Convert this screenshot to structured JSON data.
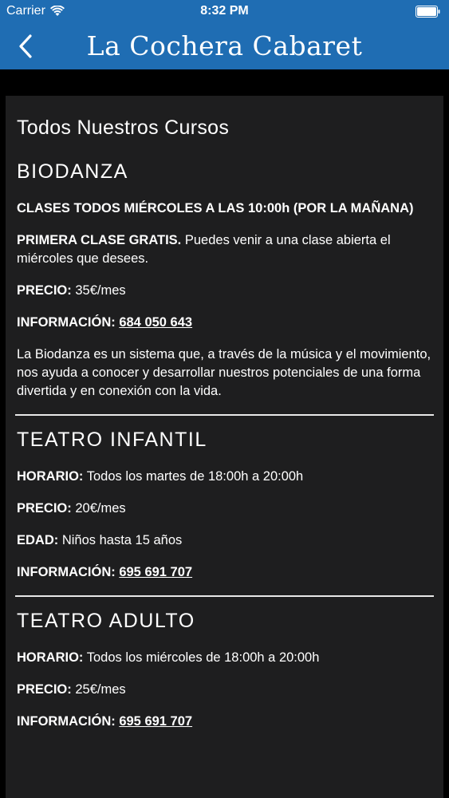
{
  "status_bar": {
    "carrier": "Carrier",
    "time": "8:32 PM"
  },
  "nav": {
    "title": "La Cochera Cabaret",
    "back_icon": "chevron-left-icon"
  },
  "colors": {
    "header_bg": "#1f6db3",
    "card_bg": "#1e1e1f",
    "page_bg": "#000000"
  },
  "page": {
    "title": "Todos Nuestros Cursos"
  },
  "courses": [
    {
      "name": "BIODANZA",
      "schedule": "CLASES TODOS MIÉRCOLES A LAS 10:00h (POR LA MAÑANA)",
      "first_class_label": "PRIMERA CLASE GRATIS.",
      "first_class_text": "Puedes venir a una clase abierta el miércoles que desees.",
      "price_label": "PRECIO:",
      "price": "35€/mes",
      "info_label": "INFORMACIÓN:",
      "phone": "684 050 643",
      "description": "La Biodanza es un sistema que, a través de la música y el movimiento, nos ayuda a conocer y desarrollar nuestros potenciales de una forma divertida y en conexión con la vida."
    },
    {
      "name": "TEATRO INFANTIL",
      "schedule_label": "HORARIO:",
      "schedule": "Todos los martes de 18:00h a 20:00h",
      "price_label": "PRECIO:",
      "price": "20€/mes",
      "age_label": "EDAD:",
      "age": "Niños hasta 15 años",
      "info_label": "INFORMACIÓN:",
      "phone": "695 691 707"
    },
    {
      "name": "TEATRO ADULTO",
      "schedule_label": "HORARIO:",
      "schedule": "Todos los miércoles de 18:00h a 20:00h",
      "price_label": "PRECIO:",
      "price": "25€/mes",
      "info_label": "INFORMACIÓN:",
      "phone": "695 691 707"
    }
  ]
}
